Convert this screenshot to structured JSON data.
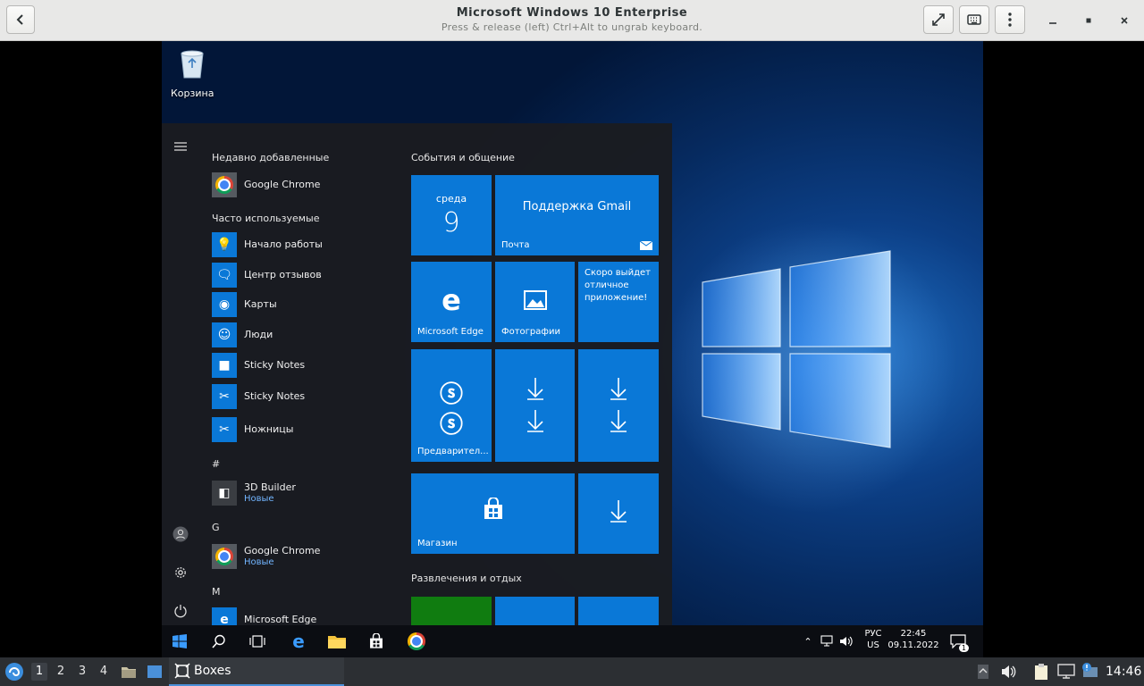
{
  "header": {
    "title": "Microsoft Windows 10 Enterprise",
    "subtitle": "Press & release (left) Ctrl+Alt to ungrab keyboard.",
    "back_icon": "chevron-left-icon",
    "fullscreen_icon": "fullscreen-icon",
    "keyboard_icon": "keyboard-icon",
    "menu_icon": "vertical-dots-icon",
    "minimize_icon": "minimize-icon",
    "maximize_icon": "maximize-icon",
    "close_icon": "close-icon"
  },
  "desktop": {
    "recycle_bin_label": "Корзина"
  },
  "start_menu": {
    "recent_title": "Недавно добавленные",
    "recent_apps": [
      {
        "name": "Google Chrome",
        "icon": "chrome-icon"
      }
    ],
    "frequent_title": "Часто используемые",
    "frequent_apps": [
      {
        "name": "Начало работы",
        "icon": "lightbulb-icon"
      },
      {
        "name": "Центр отзывов",
        "icon": "feedback-icon"
      },
      {
        "name": "Карты",
        "icon": "map-pin-icon"
      },
      {
        "name": "Люди",
        "icon": "people-icon"
      },
      {
        "name": "Sticky Notes",
        "icon": "sticky-notes-icon"
      },
      {
        "name": "Sticky Notes",
        "icon": "snipping-icon"
      },
      {
        "name": "Ножницы",
        "icon": "scissors-icon"
      }
    ],
    "letters": [
      "#",
      "G",
      "M"
    ],
    "alpha_apps": [
      {
        "name": "3D Builder",
        "sub": "Новые",
        "icon": "3d-builder-icon"
      },
      {
        "name": "Google Chrome",
        "sub": "Новые",
        "icon": "chrome-icon"
      },
      {
        "name": "Microsoft Edge",
        "sub": "",
        "icon": "edge-icon"
      }
    ],
    "tiles_group1": "События и общение",
    "tiles_group2": "Развлечения и отдых",
    "calendar_day": "среда",
    "calendar_date": "9",
    "mail_title": "Поддержка Gmail",
    "mail_label": "Почта",
    "edge_label": "Microsoft Edge",
    "photos_label": "Фотографии",
    "coming_soon": "Скоро выйдет отличное приложение!",
    "skype_label": "Предварител...",
    "store_label": "Магазин"
  },
  "win_taskbar": {
    "lang_top": "РУС",
    "lang_bottom": "US",
    "time": "22:45",
    "date": "09.11.2022",
    "notifications_count": "1"
  },
  "host_panel": {
    "workspaces": [
      "1",
      "2",
      "3",
      "4"
    ],
    "active_workspace": "1",
    "task_label": "Boxes",
    "clock": "14:46"
  },
  "colors": {
    "tile_blue": "#0a78d7",
    "accent_green": "#107c10"
  }
}
